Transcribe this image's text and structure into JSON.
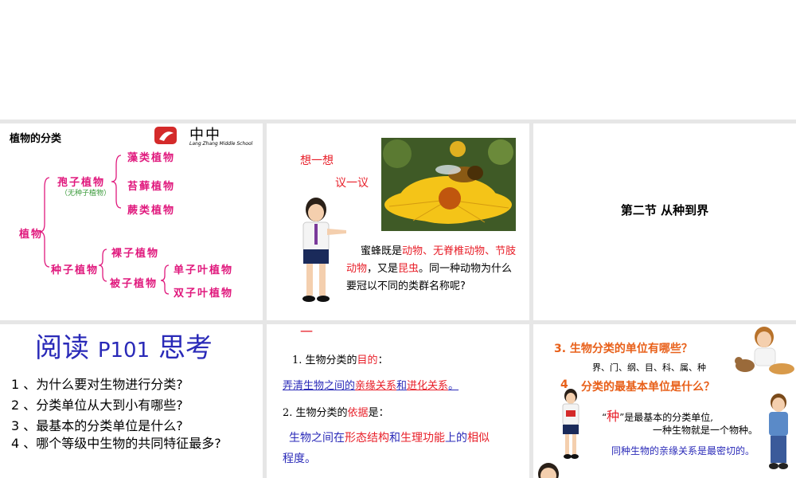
{
  "slide1": {
    "title": "植物的分类",
    "logo_cn": "中中",
    "logo_en": "Lang Zhang Middle School",
    "root": "植物",
    "spore": "孢子植物",
    "spore_note": "（无种子植物）",
    "algae": "藻类植物",
    "moss": "苔藓植物",
    "fern": "蕨类植物",
    "seed": "种子植物",
    "gymno": "裸子植物",
    "angio": "被子植物",
    "mono": "单子叶植物",
    "dicot": "双子叶植物"
  },
  "slide2": {
    "think": "想一想",
    "discuss": "议一议",
    "text_prefix": "蜜蜂既是",
    "kw1": "动物",
    "sep1": "、",
    "kw2": "无脊椎动物",
    "sep2": "、",
    "kw3": "节肢动物",
    "mid": "，又是",
    "kw4": "昆虫",
    "tail": "。同一种动物为什么要冠以不同的类群名称呢?"
  },
  "slide3": {
    "title": "第二节  从种到界"
  },
  "slide4": {
    "heading_a": "阅读",
    "heading_b": "P101",
    "heading_c": "思考",
    "q1": "1 、为什么要对生物进行分类?",
    "q2": "2 、分类单位从大到小有哪些?",
    "q3": "3 、最基本的分类单位是什么?",
    "q4": "4 、哪个等级中生物的共同特征最多?"
  },
  "slide5": {
    "dash": "一",
    "p1_label": "1. 生物分类的",
    "p1_kw": "目的",
    "p1_colon": "：",
    "a1_pre": "弄清生物之间的",
    "a1_kw1": "亲缘关系",
    "a1_and": "和",
    "a1_kw2": "进化关系",
    "a1_end": "。",
    "p2_label": "2. 生物分类的",
    "p2_kw": "依据",
    "p2_colon": "是：",
    "a2_pre": "生物之间在",
    "a2_kw1": "形态结构",
    "a2_and": "和",
    "a2_kw2": "生理功能",
    "a2_mid": "上的",
    "a2_kw3": "相似",
    "a2_end": "程度。"
  },
  "slide6": {
    "q3": "3. 生物分类的单位有哪些？",
    "ranks": "界、门、纲、目、科、属、种",
    "q4_num": "4",
    "q4": "分类的最基本单位是什么？",
    "def_quote_open": "“",
    "def_kw": "种",
    "def_text": "”是最基本的分类单位,",
    "def_line2": "一种生物就是一个物种。",
    "def_line3": "同种生物的亲缘关系是最密切的。"
  },
  "colors": {
    "magenta": "#e0197d",
    "red": "#e8202a",
    "blue": "#2a2ab8",
    "orange": "#e8601a",
    "grid": "#e6e6e6"
  }
}
